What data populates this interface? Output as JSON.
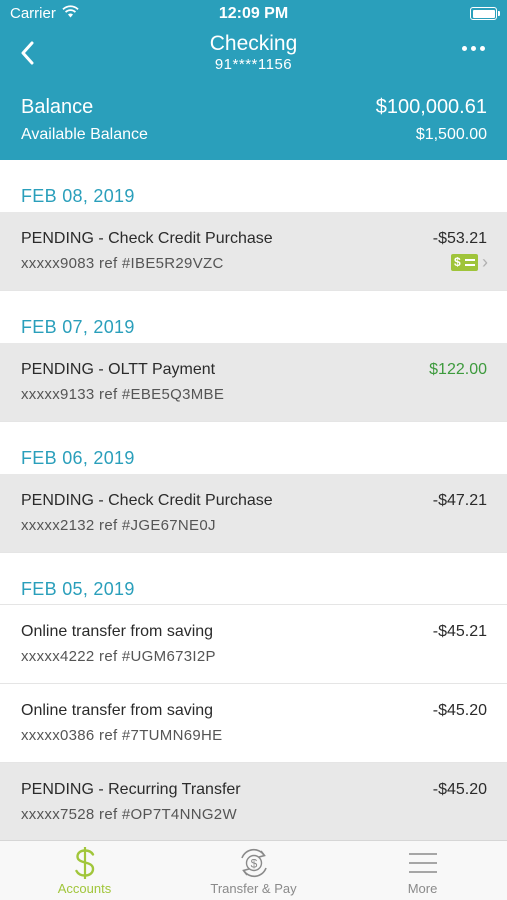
{
  "status_bar": {
    "carrier": "Carrier",
    "time": "12:09 PM"
  },
  "nav": {
    "title": "Checking",
    "account_number": "91****1156"
  },
  "balance": {
    "label": "Balance",
    "value": "$100,000.61",
    "available_label": "Available Balance",
    "available_value": "$1,500.00"
  },
  "groups": [
    {
      "date": "FEB 08, 2019",
      "transactions": [
        {
          "description": "PENDING - Check Credit Purchase",
          "ref": "xxxxx9083 ref #IBE5R29VZC",
          "amount": "-$53.21",
          "pending": true,
          "has_check": true
        }
      ]
    },
    {
      "date": "FEB 07, 2019",
      "transactions": [
        {
          "description": "PENDING - OLTT Payment",
          "ref": "xxxxx9133 ref #EBE5Q3MBE",
          "amount": "$122.00",
          "pending": true,
          "positive": true
        }
      ]
    },
    {
      "date": "FEB 06, 2019",
      "transactions": [
        {
          "description": "PENDING - Check Credit Purchase",
          "ref": "xxxxx2132 ref #JGE67NE0J",
          "amount": "-$47.21",
          "pending": true
        }
      ]
    },
    {
      "date": "FEB 05, 2019",
      "transactions": [
        {
          "description": "Online transfer from saving",
          "ref": "xxxxx4222 ref #UGM673I2P",
          "amount": "-$45.21",
          "pending": false
        },
        {
          "description": "Online transfer from saving",
          "ref": "xxxxx0386 ref #7TUMN69HE",
          "amount": "-$45.20",
          "pending": false
        },
        {
          "description": "PENDING - Recurring Transfer",
          "ref": "xxxxx7528 ref #OP7T4NNG2W",
          "amount": "-$45.20",
          "pending": true
        }
      ]
    }
  ],
  "tabs": [
    {
      "label": "Accounts",
      "icon": "dollar-icon",
      "active": true
    },
    {
      "label": "Transfer & Pay",
      "icon": "transfer-icon",
      "active": false
    },
    {
      "label": "More",
      "icon": "menu-icon",
      "active": false
    }
  ],
  "colors": {
    "header": "#2a9fbb",
    "accent_green": "#a1c63b",
    "positive_amount": "#3d9a3d",
    "pending_bg": "#e8e8e8"
  }
}
